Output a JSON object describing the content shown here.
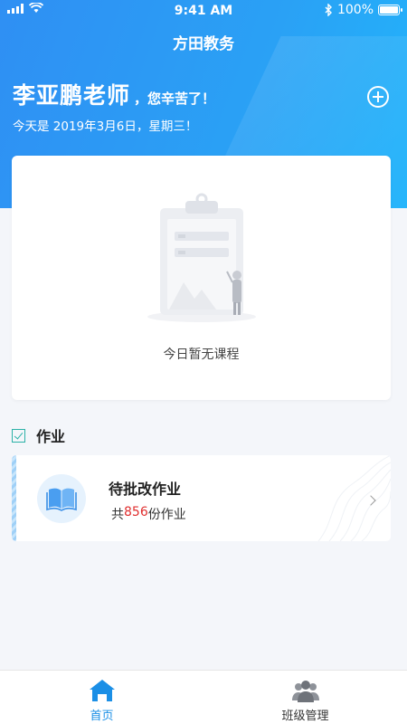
{
  "status_bar": {
    "time": "9:41 AM",
    "battery": "100%"
  },
  "header": {
    "title": "方田教务",
    "teacher_name": "李亚鹏老师",
    "greeting_suffix": "，您辛苦了！",
    "date_text": "今天是 2019年3月6日，星期三！"
  },
  "course_card": {
    "empty_text": "今日暂无课程"
  },
  "homework_section": {
    "title": "作业",
    "card": {
      "title": "待批改作业",
      "count_prefix": "共",
      "count": "856",
      "count_suffix": "份作业"
    }
  },
  "tab_bar": {
    "items": [
      {
        "label": "首页",
        "active": true,
        "icon": "home-icon"
      },
      {
        "label": "班级管理",
        "active": false,
        "icon": "users-icon"
      }
    ]
  },
  "colors": {
    "primary": "#2f8ff3",
    "accent_red": "#e02f2f",
    "check_green": "#2bb1a7"
  }
}
